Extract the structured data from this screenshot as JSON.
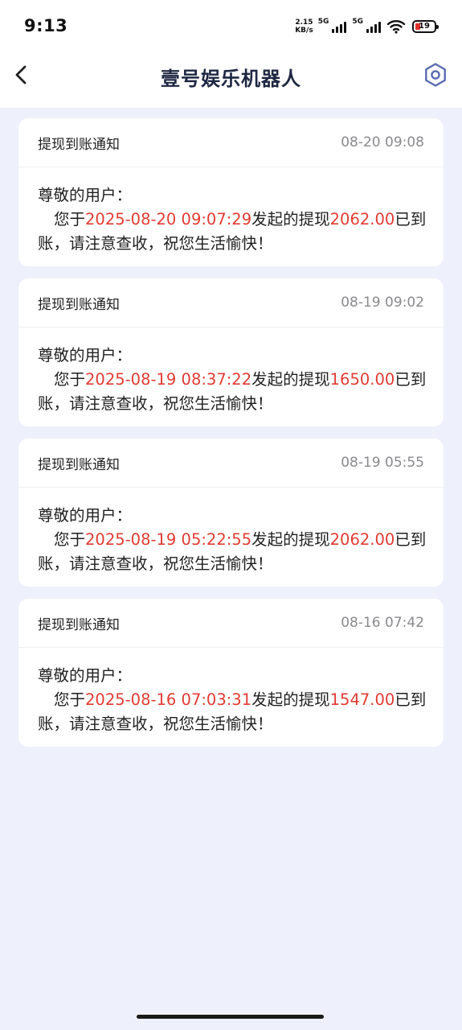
{
  "status_bar": {
    "time": "9:13",
    "speed_value": "2.15",
    "speed_unit": "KB/s",
    "sim1": "5G",
    "sim2": "5G",
    "battery": "19"
  },
  "header": {
    "title": "壹号娱乐机器人"
  },
  "notifications": [
    {
      "title": "提现到账通知",
      "time": "08-20 09:08",
      "greeting": "尊敬的用户：",
      "prefix": "您于",
      "datetime": "2025-08-20 09:07:29",
      "middle": "发起的提现",
      "amount": "2062.00",
      "suffix": "已到账，请注意查收，祝您生活愉快！"
    },
    {
      "title": "提现到账通知",
      "time": "08-19 09:02",
      "greeting": "尊敬的用户：",
      "prefix": "您于",
      "datetime": "2025-08-19 08:37:22",
      "middle": "发起的提现",
      "amount": "1650.00",
      "suffix": "已到账，请注意查收，祝您生活愉快！"
    },
    {
      "title": "提现到账通知",
      "time": "08-19 05:55",
      "greeting": "尊敬的用户：",
      "prefix": "您于",
      "datetime": "2025-08-19 05:22:55",
      "middle": "发起的提现",
      "amount": "2062.00",
      "suffix": "已到账，请注意查收，祝您生活愉快！"
    },
    {
      "title": "提现到账通知",
      "time": "08-16 07:42",
      "greeting": "尊敬的用户：",
      "prefix": "您于",
      "datetime": "2025-08-16 07:03:31",
      "middle": "发起的提现",
      "amount": "1547.00",
      "suffix": "已到账，请注意查收，祝您生活愉快！"
    }
  ],
  "icons": {
    "back": "chevron-left-icon",
    "settings": "gear-icon",
    "wifi": "wifi-icon",
    "battery": "battery-icon"
  },
  "colors": {
    "highlight": "#e23b33",
    "background": "#eef0fb",
    "title": "#1e2742"
  }
}
